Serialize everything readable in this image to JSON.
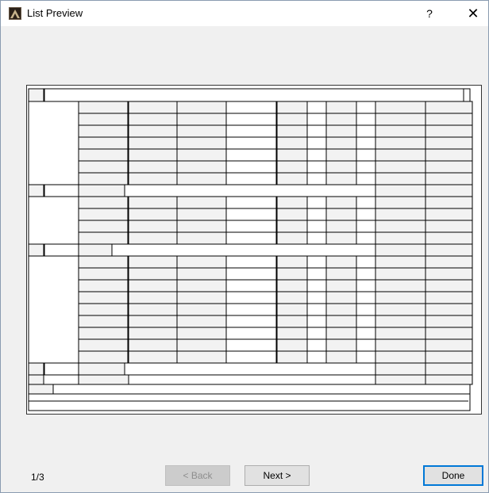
{
  "window": {
    "title": "List Preview",
    "help_label": "?",
    "close_label": "✕"
  },
  "icons": {
    "app": "archicad-app-icon",
    "help": "help-icon",
    "close": "close-icon"
  },
  "preview": {
    "description_groups": 3,
    "rows_per_group": [
      7,
      4,
      9
    ]
  },
  "footer": {
    "page_indicator": "1/3",
    "back_label": "< Back",
    "next_label": "Next >",
    "done_label": "Done",
    "back_enabled": false
  },
  "colors": {
    "titlebar": "#ffffff",
    "dialog_bg": "#f0f0f0",
    "preview_bg": "#ffffff",
    "cell_fill": "#f2f2f2",
    "default_button_border": "#0078d7"
  }
}
